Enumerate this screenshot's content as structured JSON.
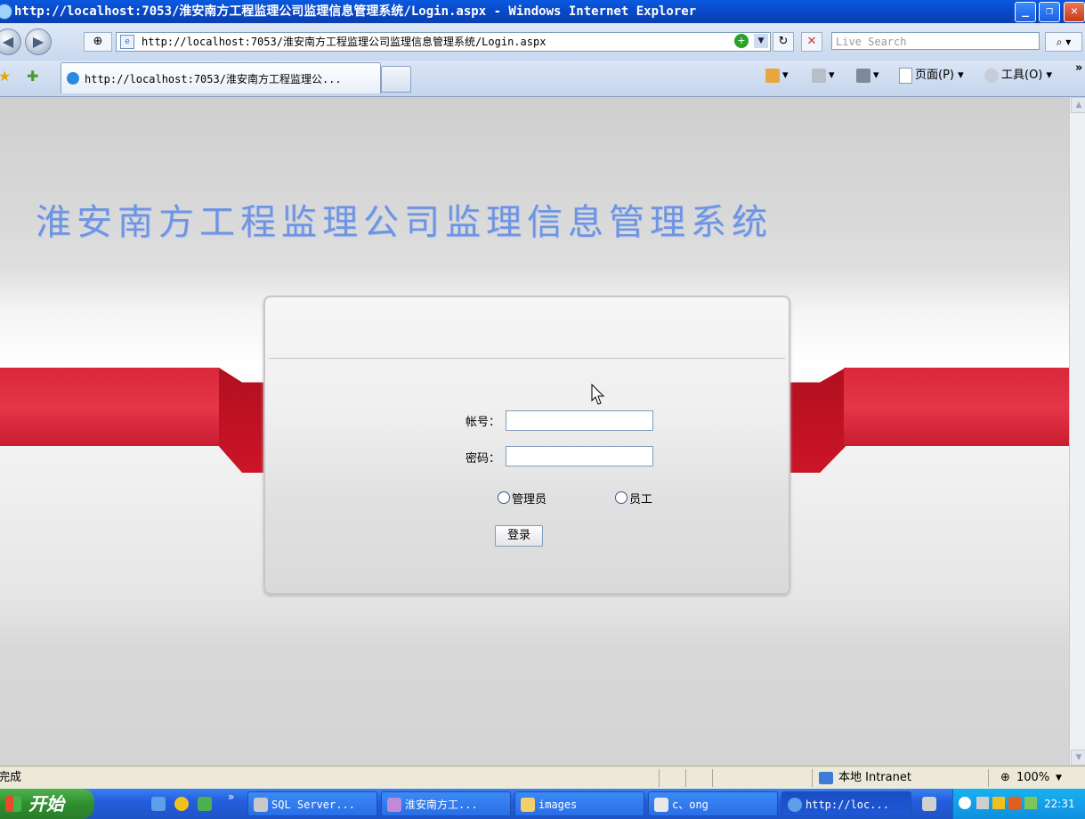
{
  "window": {
    "title": "http://localhost:7053/淮安南方工程监理公司监理信息管理系统/Login.aspx - Windows Internet Explorer",
    "minimize": "_",
    "maximize": "❐",
    "close": "✕"
  },
  "address": {
    "url": "http://localhost:7053/淮安南方工程监理公司监理信息管理系统/Login.aspx",
    "search_placeholder": "Live Search",
    "back": "◀",
    "forward": "▶",
    "go": "+",
    "refresh": "↻",
    "stop": "✕",
    "search_go": "⌕ ▾"
  },
  "tabbar": {
    "tab_label": "http://localhost:7053/淮安南方工程监理公...",
    "home_label": "▾",
    "feeds_label": "▾",
    "print_label": "▾",
    "page_menu": "页面(P) ▾",
    "tools_menu": "工具(O) ▾",
    "more": "»"
  },
  "page": {
    "heading": "淮安南方工程监理公司监理信息管理系统",
    "account_label": "帐号：",
    "password_label": "密码：",
    "account_value": "",
    "password_value": "",
    "role_admin": "管理员",
    "role_staff": "员工",
    "login_button": "登录"
  },
  "status": {
    "text": "完成",
    "zone": "本地 Intranet",
    "zoom": "100%"
  },
  "taskbar": {
    "start": "开始",
    "tasks": [
      "SQL Server...",
      "淮安南方工...",
      "images",
      "c、ong",
      "http://loc..."
    ],
    "clock": "22:31"
  },
  "colors": {
    "heading": "#6f94e0",
    "ribbon": "#d8283a",
    "titlebar": "#0a4fd6",
    "taskbar": "#245edc"
  }
}
